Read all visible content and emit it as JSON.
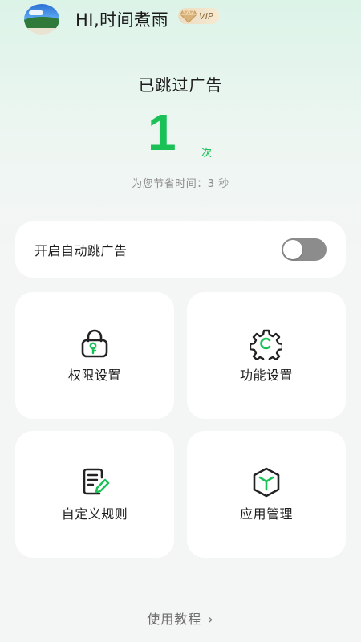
{
  "header": {
    "username": "HI,时间煮雨",
    "vip_label": "VIP",
    "avatar_icon": "landscape-avatar"
  },
  "stats": {
    "title": "已跳过广告",
    "count": "1",
    "count_unit": "次",
    "saved_time": "为您节省时间：3 秒"
  },
  "auto_skip": {
    "label": "开启自动跳广告",
    "enabled": false
  },
  "tiles": [
    {
      "label": "权限设置",
      "icon": "lock-key-icon"
    },
    {
      "label": "功能设置",
      "icon": "gear-icon"
    },
    {
      "label": "自定义规则",
      "icon": "document-edit-icon"
    },
    {
      "label": "应用管理",
      "icon": "cube-icon"
    }
  ],
  "footer": {
    "tutorial_label": "使用教程",
    "chevron_icon": "chevron-right-icon"
  },
  "colors": {
    "accent": "#19c157",
    "switch_off": "#8c8c8c",
    "card_bg": "#ffffff",
    "page_bg": "#f4f5f5"
  }
}
